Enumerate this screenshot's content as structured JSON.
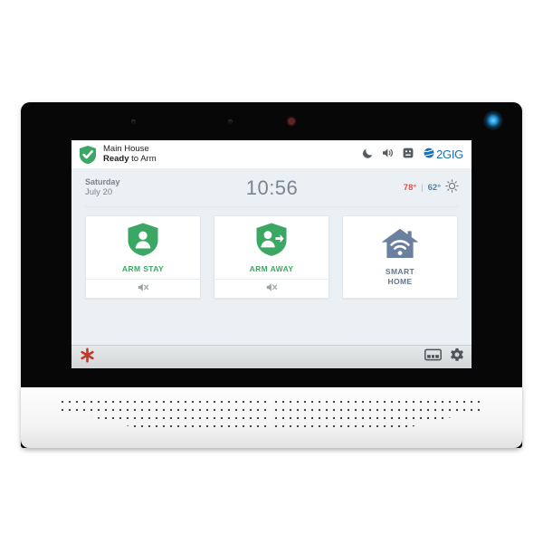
{
  "device": {
    "name": "2GIG security touchscreen panel",
    "led_color": "#2196d9",
    "camera_indicator_color": "#5e2323"
  },
  "screen": {
    "header": {
      "shield_icon": "shield-check-icon",
      "shield_color": "#3aa864",
      "site_name": "Main House",
      "ready_bold": "Ready",
      "ready_rest": " to Arm",
      "icons": [
        {
          "name": "moon-icon",
          "label": "Night mode"
        },
        {
          "name": "speaker-icon",
          "label": "Sound"
        },
        {
          "name": "panel-square-icon",
          "label": "Panel"
        }
      ],
      "brand": {
        "icon": "globe-icon",
        "text": "2GIG",
        "color": "#1b6fb5"
      }
    },
    "info": {
      "day": "Saturday",
      "date": "July 20",
      "time": "10:56",
      "weather": {
        "high": "78°",
        "separator": "|",
        "low": "62°",
        "high_color": "#d4574e",
        "low_color": "#5c7fa8",
        "icon": "sun-icon"
      }
    },
    "cards": [
      {
        "id": "arm-stay",
        "label": "ARM STAY",
        "icon": "shield-person-icon",
        "icon_color": "#3aa864",
        "label_color": "#3aa864",
        "footer_icon": "speaker-muted-icon",
        "has_footer": true
      },
      {
        "id": "arm-away",
        "label": "ARM AWAY",
        "icon": "shield-person-arrow-icon",
        "icon_color": "#3aa864",
        "label_color": "#3aa864",
        "footer_icon": "speaker-muted-icon",
        "has_footer": true
      },
      {
        "id": "smart-home",
        "label_line1": "SMART",
        "label_line2": "HOME",
        "icon": "house-wifi-icon",
        "icon_color": "#64748b",
        "label_color": "#64748b",
        "has_footer": false
      }
    ],
    "footer": {
      "emergency_icon": "asterisk-emergency-icon",
      "emergency_color": "#c0392b",
      "right_icons": [
        {
          "name": "keypad-icon",
          "label": "Keypad"
        },
        {
          "name": "gear-icon",
          "label": "Settings"
        }
      ]
    }
  }
}
